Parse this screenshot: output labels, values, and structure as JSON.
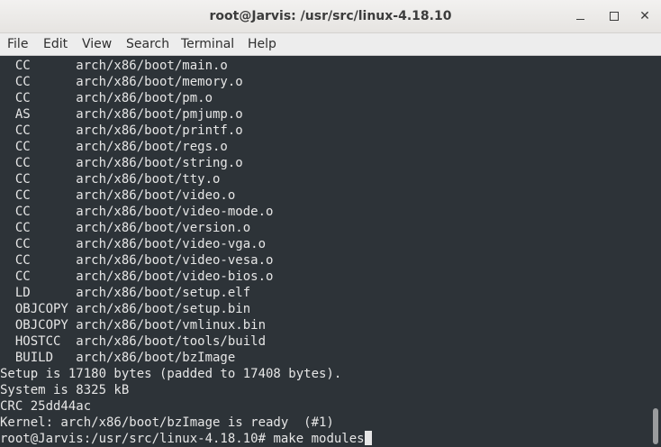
{
  "window": {
    "title": "root@Jarvis: /usr/src/linux-4.18.10",
    "controls": {
      "minimize_icon": "minimize-icon",
      "maximize_icon": "maximize-icon",
      "close_icon": "close-icon"
    }
  },
  "menu": [
    "File",
    "Edit",
    "View",
    "Search",
    "Terminal",
    "Help"
  ],
  "terminal": {
    "lines": [
      "  CC      arch/x86/boot/main.o",
      "  CC      arch/x86/boot/memory.o",
      "  CC      arch/x86/boot/pm.o",
      "  AS      arch/x86/boot/pmjump.o",
      "  CC      arch/x86/boot/printf.o",
      "  CC      arch/x86/boot/regs.o",
      "  CC      arch/x86/boot/string.o",
      "  CC      arch/x86/boot/tty.o",
      "  CC      arch/x86/boot/video.o",
      "  CC      arch/x86/boot/video-mode.o",
      "  CC      arch/x86/boot/version.o",
      "  CC      arch/x86/boot/video-vga.o",
      "  CC      arch/x86/boot/video-vesa.o",
      "  CC      arch/x86/boot/video-bios.o",
      "  LD      arch/x86/boot/setup.elf",
      "  OBJCOPY arch/x86/boot/setup.bin",
      "  OBJCOPY arch/x86/boot/vmlinux.bin",
      "  HOSTCC  arch/x86/boot/tools/build",
      "  BUILD   arch/x86/boot/bzImage",
      "Setup is 17180 bytes (padded to 17408 bytes).",
      "System is 8325 kB",
      "CRC 25dd44ac",
      "Kernel: arch/x86/boot/bzImage is ready  (#1)"
    ],
    "prompt": "root@Jarvis:/usr/src/linux-4.18.10#",
    "command": " make modules"
  },
  "colors": {
    "terminal_bg": "#2d3338",
    "terminal_fg": "#e6e6e6",
    "titlebar_bg": "#e6e4e1"
  }
}
